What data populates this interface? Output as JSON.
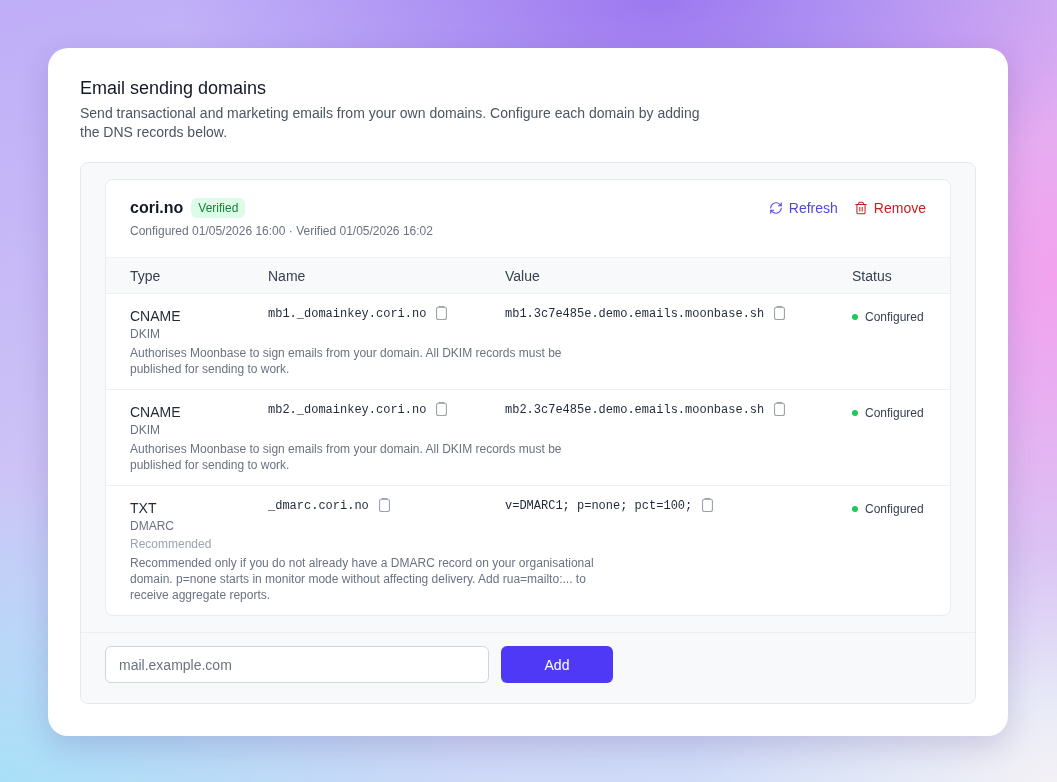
{
  "page": {
    "title": "Email sending domains",
    "description": "Send transactional and marketing emails from your own domains. Configure each domain by adding the DNS records below."
  },
  "domains": [
    {
      "name": "cori.no",
      "badge": {
        "label": "Verified",
        "kind": "verified"
      },
      "meta": "Configured 01/05/2026 16:00 · Verified 01/05/2026 16:02",
      "actions": [
        {
          "kind": "refresh",
          "label": "Refresh"
        },
        {
          "kind": "remove",
          "label": "Remove"
        }
      ],
      "table": {
        "columns": [
          "Type",
          "Name",
          "Value",
          "Status"
        ],
        "rows": [
          {
            "type": "CNAME",
            "purpose": "DKIM",
            "name": "mb1._domainkey.cori.no",
            "value": "mb1.3c7e485e.demo.emails.moonbase.sh",
            "status": {
              "label": "Configured",
              "color": "#22c55e"
            },
            "description": "Authorises Moonbase to sign emails from your domain. All DKIM records must be published for sending to work."
          },
          {
            "type": "CNAME",
            "purpose": "DKIM",
            "name": "mb2._domainkey.cori.no",
            "value": "mb2.3c7e485e.demo.emails.moonbase.sh",
            "status": {
              "label": "Configured",
              "color": "#22c55e"
            },
            "description": "Authorises Moonbase to sign emails from your domain. All DKIM records must be published for sending to work."
          },
          {
            "type": "TXT",
            "purpose": "DMARC",
            "tag": "Recommended",
            "name": "_dmarc.cori.no",
            "value": "v=DMARC1; p=none; pct=100;",
            "status": {
              "label": "Configured",
              "color": "#22c55e"
            },
            "description": "Recommended only if you do not already have a DMARC record on your organisational domain. p=none starts in monitor mode without affecting delivery. Add rua=mailto:... to receive aggregate reports."
          }
        ]
      }
    }
  ],
  "add_form": {
    "placeholder": "mail.example.com",
    "button": "Add"
  }
}
